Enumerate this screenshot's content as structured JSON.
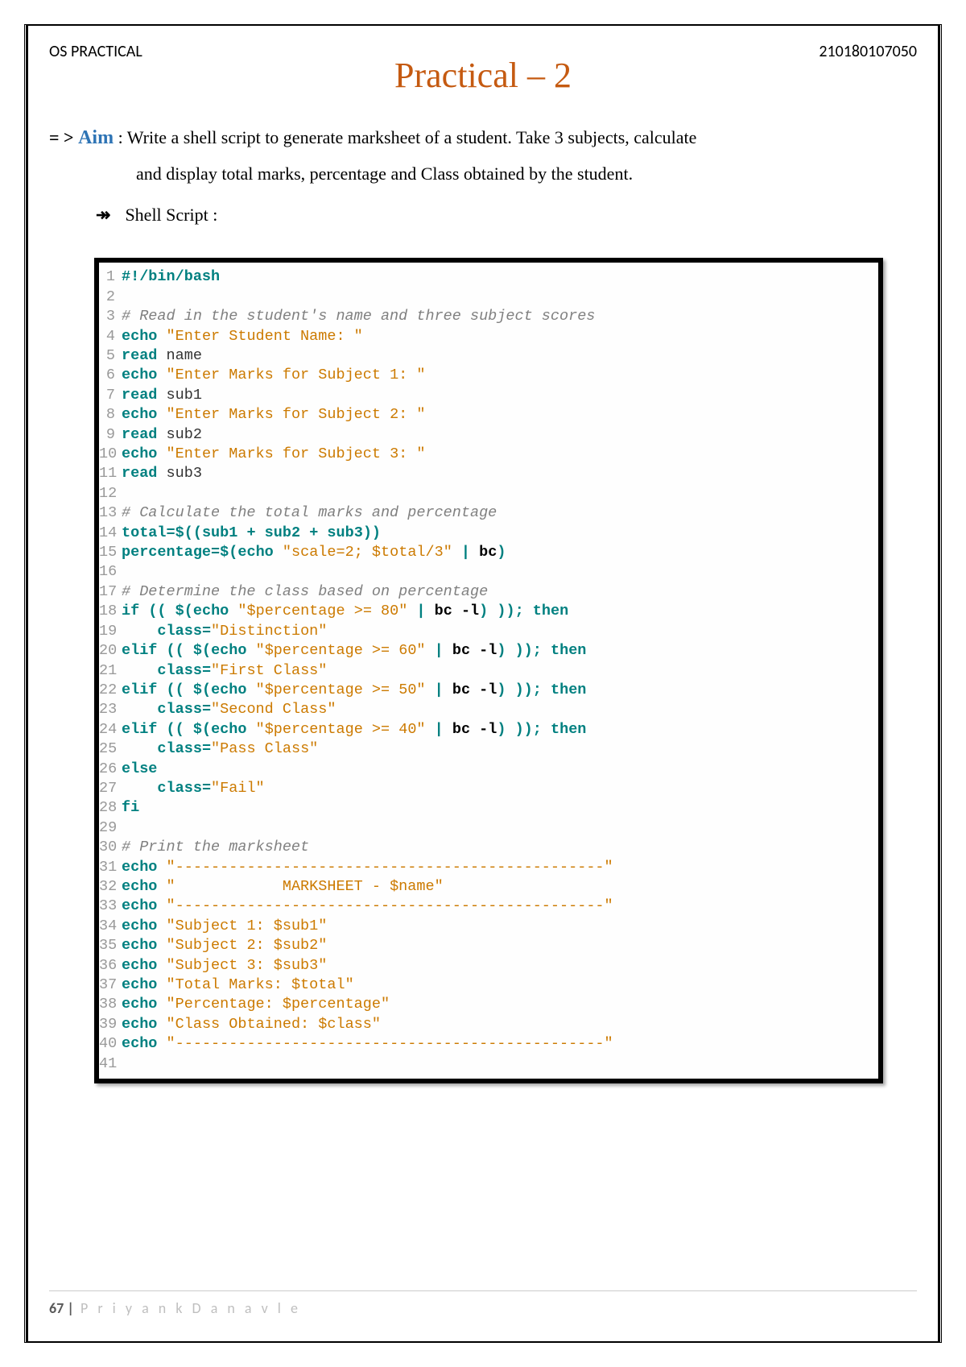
{
  "header": {
    "left": "OS PRACTICAL",
    "right": "210180107050"
  },
  "title": "Practical – 2",
  "aim": {
    "prefix": "= > ",
    "label": "Aim",
    "colon": " :  ",
    "line1": "Write a shell script to generate marksheet of a student. Take 3 subjects, calculate",
    "line2": "and display total marks, percentage and Class obtained by the student."
  },
  "shell_label_bullet": "↠",
  "shell_label": "Shell Script :",
  "code": [
    {
      "n": "1",
      "segs": [
        {
          "c": "kw",
          "t": "#!/bin/bash"
        }
      ]
    },
    {
      "n": "2",
      "segs": []
    },
    {
      "n": "3",
      "segs": [
        {
          "c": "comment",
          "t": "# Read in the student's name and three subject scores"
        }
      ]
    },
    {
      "n": "4",
      "segs": [
        {
          "c": "kw",
          "t": "echo"
        },
        {
          "c": "plain",
          "t": " "
        },
        {
          "c": "string",
          "t": "\"Enter Student Name: \""
        }
      ]
    },
    {
      "n": "5",
      "segs": [
        {
          "c": "kw",
          "t": "read"
        },
        {
          "c": "plain",
          "t": " name"
        }
      ]
    },
    {
      "n": "6",
      "segs": [
        {
          "c": "kw",
          "t": "echo"
        },
        {
          "c": "plain",
          "t": " "
        },
        {
          "c": "string",
          "t": "\"Enter Marks for Subject 1: \""
        }
      ]
    },
    {
      "n": "7",
      "segs": [
        {
          "c": "kw",
          "t": "read"
        },
        {
          "c": "plain",
          "t": " sub1"
        }
      ]
    },
    {
      "n": "8",
      "segs": [
        {
          "c": "kw",
          "t": "echo"
        },
        {
          "c": "plain",
          "t": " "
        },
        {
          "c": "string",
          "t": "\"Enter Marks for Subject 2: \""
        }
      ]
    },
    {
      "n": "9",
      "segs": [
        {
          "c": "kw",
          "t": "read"
        },
        {
          "c": "plain",
          "t": " sub2"
        }
      ]
    },
    {
      "n": "10",
      "segs": [
        {
          "c": "kw",
          "t": "echo"
        },
        {
          "c": "plain",
          "t": " "
        },
        {
          "c": "string",
          "t": "\"Enter Marks for Subject 3: \""
        }
      ]
    },
    {
      "n": "11",
      "segs": [
        {
          "c": "kw",
          "t": "read"
        },
        {
          "c": "plain",
          "t": " sub3"
        }
      ]
    },
    {
      "n": "12",
      "segs": []
    },
    {
      "n": "13",
      "segs": [
        {
          "c": "comment",
          "t": "# Calculate the total marks and percentage"
        }
      ]
    },
    {
      "n": "14",
      "segs": [
        {
          "c": "var",
          "t": "total"
        },
        {
          "c": "op",
          "t": "="
        },
        {
          "c": "var",
          "t": "$(("
        },
        {
          "c": "var",
          "t": "sub1"
        },
        {
          "c": "op",
          "t": " + "
        },
        {
          "c": "var",
          "t": "sub2"
        },
        {
          "c": "op",
          "t": " + "
        },
        {
          "c": "var",
          "t": "sub3"
        },
        {
          "c": "var",
          "t": "))"
        }
      ]
    },
    {
      "n": "15",
      "segs": [
        {
          "c": "var",
          "t": "percentage"
        },
        {
          "c": "op",
          "t": "="
        },
        {
          "c": "var",
          "t": "$("
        },
        {
          "c": "kw",
          "t": "echo"
        },
        {
          "c": "plain",
          "t": " "
        },
        {
          "c": "string",
          "t": "\"scale=2; $total/3\""
        },
        {
          "c": "op",
          "t": " | "
        },
        {
          "c": "cmd",
          "t": "bc"
        },
        {
          "c": "var",
          "t": ")"
        }
      ]
    },
    {
      "n": "16",
      "segs": []
    },
    {
      "n": "17",
      "segs": [
        {
          "c": "comment",
          "t": "# Determine the class based on percentage"
        }
      ]
    },
    {
      "n": "18",
      "segs": [
        {
          "c": "kw",
          "t": "if"
        },
        {
          "c": "plain",
          "t": " "
        },
        {
          "c": "op",
          "t": "(( "
        },
        {
          "c": "var",
          "t": "$("
        },
        {
          "c": "kw",
          "t": "echo"
        },
        {
          "c": "plain",
          "t": " "
        },
        {
          "c": "string",
          "t": "\"$percentage >= 80\""
        },
        {
          "c": "op",
          "t": " | "
        },
        {
          "c": "cmd",
          "t": "bc -l"
        },
        {
          "c": "var",
          "t": ")"
        },
        {
          "c": "op",
          "t": " )); "
        },
        {
          "c": "kw",
          "t": "then"
        }
      ]
    },
    {
      "n": "19",
      "segs": [
        {
          "c": "plain",
          "t": "    "
        },
        {
          "c": "var",
          "t": "class"
        },
        {
          "c": "op",
          "t": "="
        },
        {
          "c": "string",
          "t": "\"Distinction\""
        }
      ]
    },
    {
      "n": "20",
      "segs": [
        {
          "c": "kw",
          "t": "elif"
        },
        {
          "c": "plain",
          "t": " "
        },
        {
          "c": "op",
          "t": "(( "
        },
        {
          "c": "var",
          "t": "$("
        },
        {
          "c": "kw",
          "t": "echo"
        },
        {
          "c": "plain",
          "t": " "
        },
        {
          "c": "string",
          "t": "\"$percentage >= 60\""
        },
        {
          "c": "op",
          "t": " | "
        },
        {
          "c": "cmd",
          "t": "bc -l"
        },
        {
          "c": "var",
          "t": ")"
        },
        {
          "c": "op",
          "t": " )); "
        },
        {
          "c": "kw",
          "t": "then"
        }
      ]
    },
    {
      "n": "21",
      "segs": [
        {
          "c": "plain",
          "t": "    "
        },
        {
          "c": "var",
          "t": "class"
        },
        {
          "c": "op",
          "t": "="
        },
        {
          "c": "string",
          "t": "\"First Class\""
        }
      ]
    },
    {
      "n": "22",
      "segs": [
        {
          "c": "kw",
          "t": "elif"
        },
        {
          "c": "plain",
          "t": " "
        },
        {
          "c": "op",
          "t": "(( "
        },
        {
          "c": "var",
          "t": "$("
        },
        {
          "c": "kw",
          "t": "echo"
        },
        {
          "c": "plain",
          "t": " "
        },
        {
          "c": "string",
          "t": "\"$percentage >= 50\""
        },
        {
          "c": "op",
          "t": " | "
        },
        {
          "c": "cmd",
          "t": "bc -l"
        },
        {
          "c": "var",
          "t": ")"
        },
        {
          "c": "op",
          "t": " )); "
        },
        {
          "c": "kw",
          "t": "then"
        }
      ]
    },
    {
      "n": "23",
      "segs": [
        {
          "c": "plain",
          "t": "    "
        },
        {
          "c": "var",
          "t": "class"
        },
        {
          "c": "op",
          "t": "="
        },
        {
          "c": "string",
          "t": "\"Second Class\""
        }
      ]
    },
    {
      "n": "24",
      "segs": [
        {
          "c": "kw",
          "t": "elif"
        },
        {
          "c": "plain",
          "t": " "
        },
        {
          "c": "op",
          "t": "(( "
        },
        {
          "c": "var",
          "t": "$("
        },
        {
          "c": "kw",
          "t": "echo"
        },
        {
          "c": "plain",
          "t": " "
        },
        {
          "c": "string",
          "t": "\"$percentage >= 40\""
        },
        {
          "c": "op",
          "t": " | "
        },
        {
          "c": "cmd",
          "t": "bc -l"
        },
        {
          "c": "var",
          "t": ")"
        },
        {
          "c": "op",
          "t": " )); "
        },
        {
          "c": "kw",
          "t": "then"
        }
      ]
    },
    {
      "n": "25",
      "segs": [
        {
          "c": "plain",
          "t": "    "
        },
        {
          "c": "var",
          "t": "class"
        },
        {
          "c": "op",
          "t": "="
        },
        {
          "c": "string",
          "t": "\"Pass Class\""
        }
      ]
    },
    {
      "n": "26",
      "segs": [
        {
          "c": "kw",
          "t": "else"
        }
      ]
    },
    {
      "n": "27",
      "segs": [
        {
          "c": "plain",
          "t": "    "
        },
        {
          "c": "var",
          "t": "class"
        },
        {
          "c": "op",
          "t": "="
        },
        {
          "c": "string",
          "t": "\"Fail\""
        }
      ]
    },
    {
      "n": "28",
      "segs": [
        {
          "c": "kw",
          "t": "fi"
        }
      ]
    },
    {
      "n": "29",
      "segs": []
    },
    {
      "n": "30",
      "segs": [
        {
          "c": "comment",
          "t": "# Print the marksheet"
        }
      ]
    },
    {
      "n": "31",
      "segs": [
        {
          "c": "kw",
          "t": "echo"
        },
        {
          "c": "plain",
          "t": " "
        },
        {
          "c": "string",
          "t": "\"------------------------------------------------\""
        }
      ]
    },
    {
      "n": "32",
      "segs": [
        {
          "c": "kw",
          "t": "echo"
        },
        {
          "c": "plain",
          "t": " "
        },
        {
          "c": "string",
          "t": "\"            MARKSHEET - $name\""
        }
      ]
    },
    {
      "n": "33",
      "segs": [
        {
          "c": "kw",
          "t": "echo"
        },
        {
          "c": "plain",
          "t": " "
        },
        {
          "c": "string",
          "t": "\"------------------------------------------------\""
        }
      ]
    },
    {
      "n": "34",
      "segs": [
        {
          "c": "kw",
          "t": "echo"
        },
        {
          "c": "plain",
          "t": " "
        },
        {
          "c": "string",
          "t": "\"Subject 1: $sub1\""
        }
      ]
    },
    {
      "n": "35",
      "segs": [
        {
          "c": "kw",
          "t": "echo"
        },
        {
          "c": "plain",
          "t": " "
        },
        {
          "c": "string",
          "t": "\"Subject 2: $sub2\""
        }
      ]
    },
    {
      "n": "36",
      "segs": [
        {
          "c": "kw",
          "t": "echo"
        },
        {
          "c": "plain",
          "t": " "
        },
        {
          "c": "string",
          "t": "\"Subject 3: $sub3\""
        }
      ]
    },
    {
      "n": "37",
      "segs": [
        {
          "c": "kw",
          "t": "echo"
        },
        {
          "c": "plain",
          "t": " "
        },
        {
          "c": "string",
          "t": "\"Total Marks: $total\""
        }
      ]
    },
    {
      "n": "38",
      "segs": [
        {
          "c": "kw",
          "t": "echo"
        },
        {
          "c": "plain",
          "t": " "
        },
        {
          "c": "string",
          "t": "\"Percentage: $percentage\""
        }
      ]
    },
    {
      "n": "39",
      "segs": [
        {
          "c": "kw",
          "t": "echo"
        },
        {
          "c": "plain",
          "t": " "
        },
        {
          "c": "string",
          "t": "\"Class Obtained: $class\""
        }
      ]
    },
    {
      "n": "40",
      "segs": [
        {
          "c": "kw",
          "t": "echo"
        },
        {
          "c": "plain",
          "t": " "
        },
        {
          "c": "string",
          "t": "\"------------------------------------------------\""
        }
      ]
    },
    {
      "n": "41",
      "segs": []
    }
  ],
  "footer": {
    "pageno": "67 |",
    "author": " P r i y a n k   D a n a v l e"
  }
}
